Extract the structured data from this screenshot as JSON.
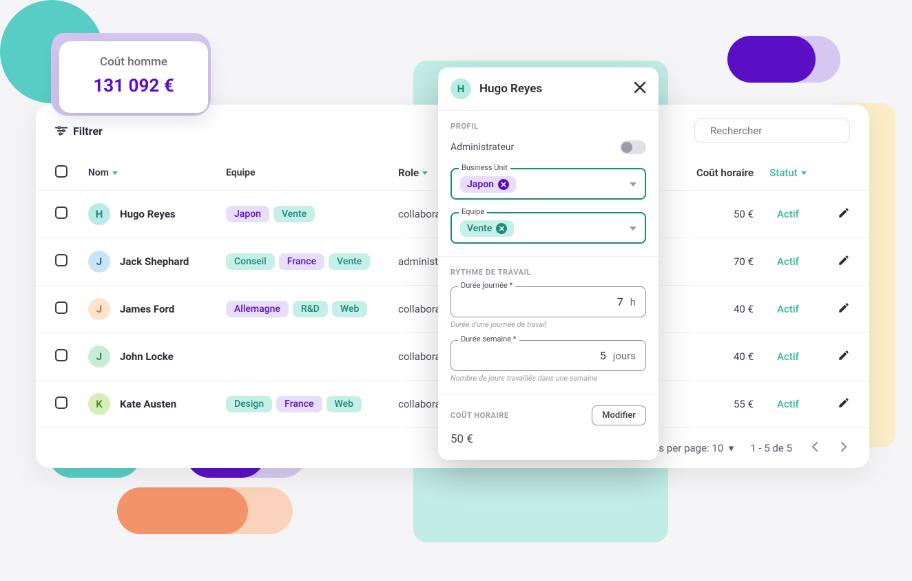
{
  "cost_card": {
    "label": "Coût homme",
    "value": "131 092 €"
  },
  "toolbar": {
    "filter": "Filtrer",
    "search_placeholder": "Rechercher"
  },
  "columns": {
    "name": "Nom",
    "team": "Equipe",
    "role": "Role",
    "cost": "Coût horaire",
    "status": "Statut"
  },
  "rows": [
    {
      "initial": "H",
      "av": "av-teal",
      "name": "Hugo Reyes",
      "tags": [
        [
          "Japon",
          "purple"
        ],
        [
          "Vente",
          "teal"
        ]
      ],
      "role": "collaborateur",
      "cost": "50 €",
      "status": "Actif"
    },
    {
      "initial": "J",
      "av": "av-blue",
      "name": "Jack Shephard",
      "tags": [
        [
          "Conseil",
          "teal"
        ],
        [
          "France",
          "purple"
        ],
        [
          "Vente",
          "teal"
        ]
      ],
      "role": "administrateur",
      "cost": "70 €",
      "status": "Actif"
    },
    {
      "initial": "J",
      "av": "av-orange",
      "name": "James Ford",
      "tags": [
        [
          "Allemagne",
          "purple"
        ],
        [
          "R&D",
          "teal"
        ],
        [
          "Web",
          "teal"
        ]
      ],
      "role": "collaborateur",
      "cost": "40 €",
      "status": "Actif"
    },
    {
      "initial": "J",
      "av": "av-green",
      "name": "John Locke",
      "tags": [],
      "role": "collaborateur",
      "cost": "40 €",
      "status": "Actif"
    },
    {
      "initial": "K",
      "av": "av-lime",
      "name": "Kate Austen",
      "tags": [
        [
          "Design",
          "teal"
        ],
        [
          "France",
          "purple"
        ],
        [
          "Web",
          "teal"
        ]
      ],
      "role": "collaborateur",
      "cost": "55 €",
      "status": "Actif"
    }
  ],
  "pager": {
    "rpp_label": "Rows per page:",
    "rpp_value": "10",
    "range": "1 - 5 de 5"
  },
  "panel": {
    "title": "Hugo Reyes",
    "initial": "H",
    "section_profile": "PROFIL",
    "admin_label": "Administrateur",
    "bu_label": "Business Unit",
    "bu_value": "Japon",
    "team_label": "Equipe",
    "team_value": "Vente",
    "section_rhythm": "RYTHME DE TRAVAIL",
    "day_label": "Durée journée *",
    "day_value": "7",
    "day_unit": "h",
    "day_helper": "Durée d'une journée de travail",
    "week_label": "Durée semaine *",
    "week_value": "5",
    "week_unit": "jours",
    "week_helper": "Nombre de jours travaillés dans une semaine",
    "section_cost": "COÛT HORAIRE",
    "modify": "Modifier",
    "hourly": "50 €"
  }
}
